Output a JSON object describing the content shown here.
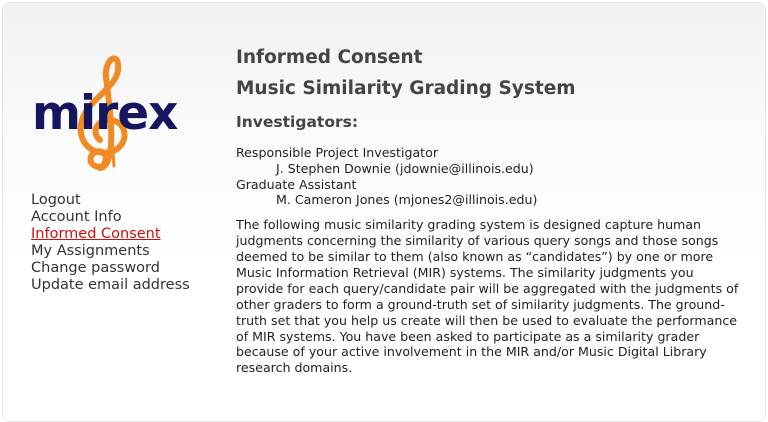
{
  "logo": {
    "text": "mirex",
    "colors": {
      "text": "#16165f",
      "clef": "#f08a24"
    },
    "icon": "treble-clef-icon"
  },
  "sidebar": {
    "items": [
      {
        "label": "Logout"
      },
      {
        "label": "Account Info"
      },
      {
        "label": "Informed Consent",
        "active": true
      },
      {
        "label": "My Assignments"
      },
      {
        "label": "Change password"
      },
      {
        "label": "Update email address"
      }
    ]
  },
  "main": {
    "title": "Informed Consent",
    "subtitle": "Music Similarity Grading System",
    "investigators_heading": "Investigators:",
    "investigators": [
      {
        "role": "Responsible Project Investigator",
        "name": "J. Stephen Downie (jdownie@illinois.edu)"
      },
      {
        "role": "Graduate Assistant",
        "name": "M. Cameron Jones (mjones2@illinois.edu)"
      }
    ],
    "paragraph": "The following music similarity grading system is designed capture human judgments concerning the similarity of various query songs and those songs deemed to be similar to them (also known as “candidates”) by one or more Music Information Retrieval (MIR) systems. The similarity judgments you provide for each query/candidate pair will be aggregated with the judgments of other graders to form a ground-truth set of similarity judgments. The ground-truth set that you help us create will then be used to evaluate the performance of MIR systems. You have been asked to participate as a similarity grader because of your active involvement in the MIR and/or Music Digital Library research domains."
  }
}
